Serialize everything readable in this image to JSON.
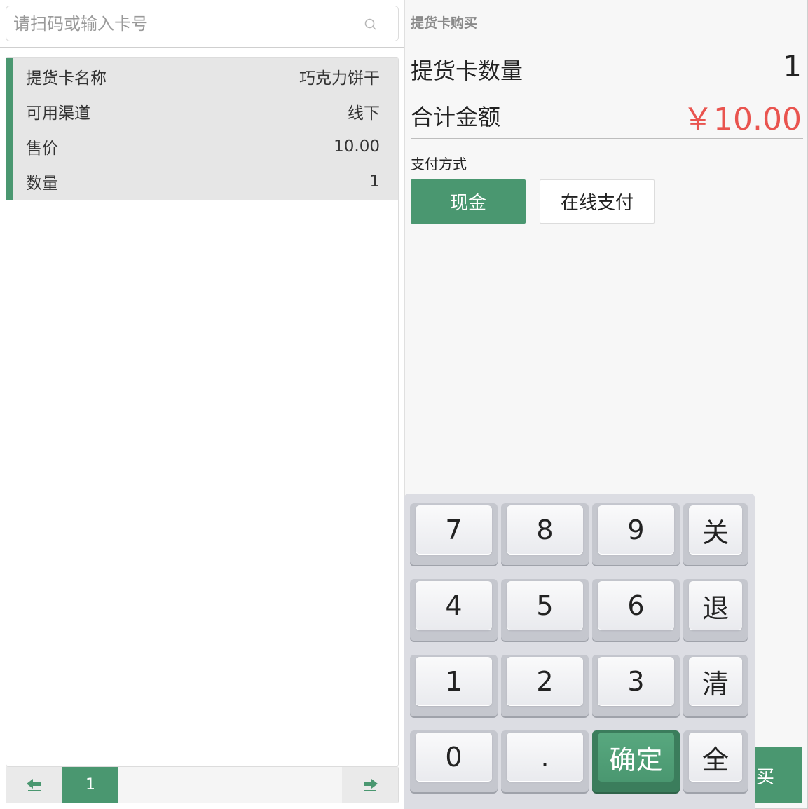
{
  "search": {
    "placeholder": "请扫码或输入卡号"
  },
  "card": {
    "rows": [
      {
        "label": "提货卡名称",
        "value": "巧克力饼干"
      },
      {
        "label": "可用渠道",
        "value": "线下"
      },
      {
        "label": "售价",
        "value": "10.00"
      },
      {
        "label": "数量",
        "value": "1"
      }
    ]
  },
  "pager": {
    "current": "1"
  },
  "right": {
    "title": "提货卡购买",
    "quantity_label": "提货卡数量",
    "quantity_value": "1",
    "total_label": "合计金额",
    "total_value": "￥10.00",
    "payment_label": "支付方式",
    "pay_cash": "现金",
    "pay_online": "在线支付",
    "buy_partial": "买"
  },
  "keypad": {
    "k7": "7",
    "k8": "8",
    "k9": "9",
    "close": "关",
    "k4": "4",
    "k5": "5",
    "k6": "6",
    "back": "退",
    "k1": "1",
    "k2": "2",
    "k3": "3",
    "clear": "清",
    "k0": "0",
    "dot": ".",
    "confirm": "确定",
    "all": "全"
  },
  "colors": {
    "accent": "#4a9770",
    "price": "#e9544f"
  },
  "icons": [
    "search-icon",
    "arrow-left-icon",
    "arrow-right-icon"
  ]
}
